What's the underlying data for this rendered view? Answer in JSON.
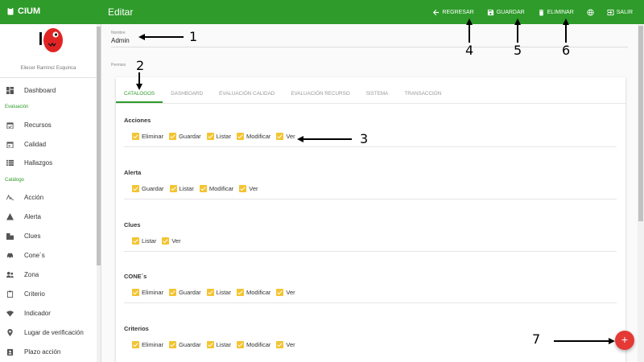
{
  "topbar": {
    "brand": "CIUM",
    "title": "Editar",
    "actions": [
      {
        "label": "REGRESAR",
        "icon": "arrow-left-icon"
      },
      {
        "label": "GUARDAR",
        "icon": "save-icon"
      },
      {
        "label": "ELIMINAR",
        "icon": "trash-icon"
      },
      {
        "label": "",
        "icon": "globe-icon"
      },
      {
        "label": "SALIR",
        "icon": "exit-icon"
      }
    ]
  },
  "sidebar": {
    "user": "Eliecer Ramírez Esquinca",
    "groups": {
      "evaluacion": "Evaluación",
      "catalogo": "Catálogo"
    },
    "items": [
      {
        "label": "Dashboard",
        "icon": "dashboard-icon"
      },
      {
        "label": "Recursos",
        "icon": "calendar-check-icon"
      },
      {
        "label": "Calidad",
        "icon": "calendar-icon"
      },
      {
        "label": "Hallazgos",
        "icon": "list-icon"
      },
      {
        "label": "Acción",
        "icon": "signature-icon"
      },
      {
        "label": "Alerta",
        "icon": "warning-icon"
      },
      {
        "label": "Clues",
        "icon": "building-icon"
      },
      {
        "label": "Cone´s",
        "icon": "car-icon"
      },
      {
        "label": "Zona",
        "icon": "people-icon"
      },
      {
        "label": "Criterio",
        "icon": "clipboard-icon"
      },
      {
        "label": "Indicador",
        "icon": "wifi-icon"
      },
      {
        "label": "Lugar de verificación",
        "icon": "location-icon"
      },
      {
        "label": "Plazo acción",
        "icon": "contact-icon"
      }
    ]
  },
  "form": {
    "name_label": "Nombre",
    "name_value": "Admin",
    "perm_label": "Permiso"
  },
  "tabs": [
    "CATALOGOS",
    "DASHBOARD",
    "EVALUACIÓN CALIDAD",
    "EVALUACIÓN RECURSO",
    "SISTEMA",
    "TRANSACCIÓN"
  ],
  "sections": [
    {
      "title": "Acciones",
      "checks": [
        "Eliminar",
        "Guardar",
        "Listar",
        "Modificar",
        "Ver"
      ]
    },
    {
      "title": "Alerta",
      "checks": [
        "Guardar",
        "Listar",
        "Modificar",
        "Ver"
      ]
    },
    {
      "title": "Clues",
      "checks": [
        "Listar",
        "Ver"
      ]
    },
    {
      "title": "CONE´s",
      "checks": [
        "Eliminar",
        "Guardar",
        "Listar",
        "Modificar",
        "Ver"
      ]
    },
    {
      "title": "Criterios",
      "checks": [
        "Eliminar",
        "Guardar",
        "Listar",
        "Modificar",
        "Ver"
      ]
    }
  ],
  "fab": "+",
  "annotations": [
    "1",
    "2",
    "3",
    "4",
    "5",
    "6",
    "7"
  ],
  "colors": {
    "primary": "#2e9b2a",
    "checkbox": "#f4c430",
    "fab": "#e53935"
  }
}
